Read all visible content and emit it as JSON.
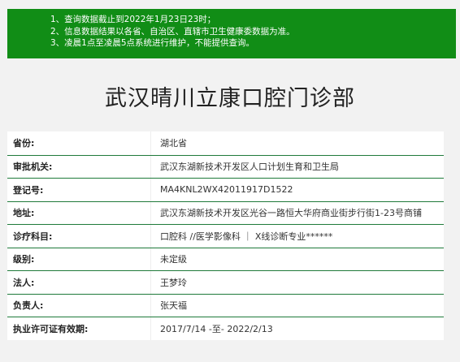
{
  "notice": {
    "lines": [
      "1、查询数据截止到2022年1月23日23时；",
      "2、信息数据结果以各省、自治区、直辖市卫生健康委数据为准。",
      "3、凌晨1点至凌晨5点系统进行维护，不能提供查询。"
    ]
  },
  "title": "武汉晴川立康口腔门诊部",
  "rows": [
    {
      "label": "省份:",
      "value": "湖北省"
    },
    {
      "label": "审批机关:",
      "value": "武汉东湖新技术开发区人口计划生育和卫生局"
    },
    {
      "label": "登记号:",
      "value": "MA4KNL2WX42011917D1522"
    },
    {
      "label": "地址:",
      "value": "武汉东湖新技术开发区光谷一路恒大华府商业街步行街1-23号商铺"
    },
    {
      "label": "诊疗科目:",
      "value": "口腔科 //医学影像科 ｜ X线诊断专业******"
    },
    {
      "label": "级别:",
      "value": "未定级"
    },
    {
      "label": "法人:",
      "value": "王梦玲"
    },
    {
      "label": "负责人:",
      "value": "张天福"
    },
    {
      "label": "执业许可证有效期:",
      "value": "2017/7/14 -至- 2022/2/13"
    }
  ]
}
